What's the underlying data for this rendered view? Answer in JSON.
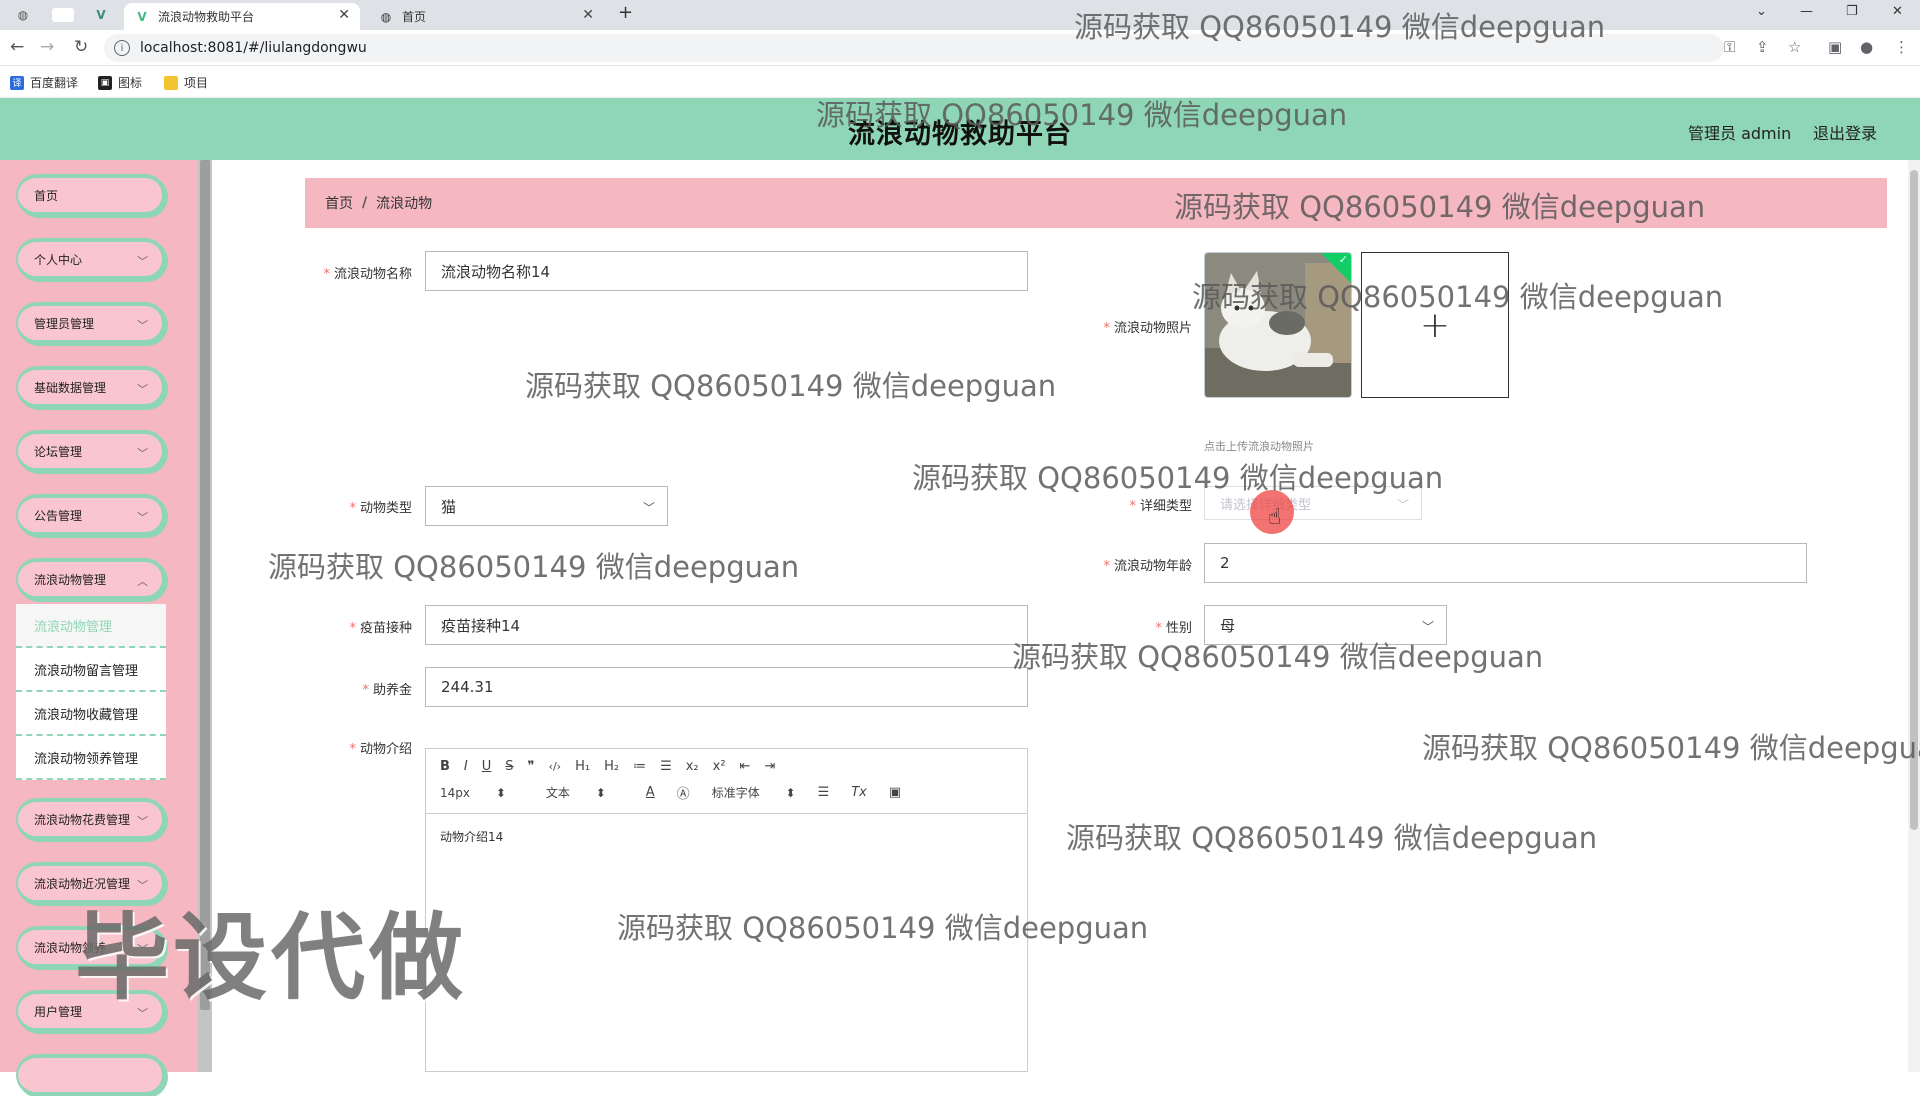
{
  "browser": {
    "tabs": [
      {
        "title": "流浪动物救助平台",
        "active": true
      },
      {
        "title": "首页",
        "active": false
      }
    ],
    "url": "localhost:8081/#/liulangdongwu",
    "bookmarks": [
      "百度翻译",
      "图标",
      "项目"
    ]
  },
  "header": {
    "title": "流浪动物救助平台",
    "user": "管理员 admin",
    "logout": "退出登录"
  },
  "sidebar": {
    "items": [
      {
        "label": "首页"
      },
      {
        "label": "个人中心"
      },
      {
        "label": "管理员管理"
      },
      {
        "label": "基础数据管理"
      },
      {
        "label": "论坛管理"
      },
      {
        "label": "公告管理"
      },
      {
        "label": "流浪动物管理"
      },
      {
        "label": "流浪动物花费管理"
      },
      {
        "label": "流浪动物近况管理"
      },
      {
        "label": "流浪动物领养"
      },
      {
        "label": "用户管理"
      }
    ],
    "submenu": [
      "流浪动物管理",
      "流浪动物留言管理",
      "流浪动物收藏管理",
      "流浪动物领养管理"
    ]
  },
  "breadcrumb": {
    "home": "首页",
    "sep": "/",
    "current": "流浪动物"
  },
  "form": {
    "name": {
      "label": "流浪动物名称",
      "value": "流浪动物名称14"
    },
    "photo": {
      "label": "流浪动物照片",
      "tip": "点击上传流浪动物照片"
    },
    "type": {
      "label": "动物类型",
      "value": "猫"
    },
    "detail_type": {
      "label": "详细类型",
      "placeholder": "请选择详细类型"
    },
    "age": {
      "label": "流浪动物年龄",
      "value": "2"
    },
    "vaccine": {
      "label": "疫苗接种",
      "value": "疫苗接种14"
    },
    "gender": {
      "label": "性别",
      "value": "母"
    },
    "fund": {
      "label": "助养金",
      "value": "244.31"
    },
    "intro": {
      "label": "动物介绍",
      "value": "动物介绍14",
      "toolbar_row1": [
        "B",
        "I",
        "U",
        "S",
        "❞",
        "‹/›",
        "H₁",
        "H₂",
        "≔",
        "☰",
        "x₂",
        "x²",
        "⇤",
        "⇥"
      ],
      "size": "14px",
      "format": "文本",
      "font": "标准字体"
    }
  },
  "watermark": "源码获取 QQ86050149 微信deepguan",
  "stamp": "毕设代做"
}
